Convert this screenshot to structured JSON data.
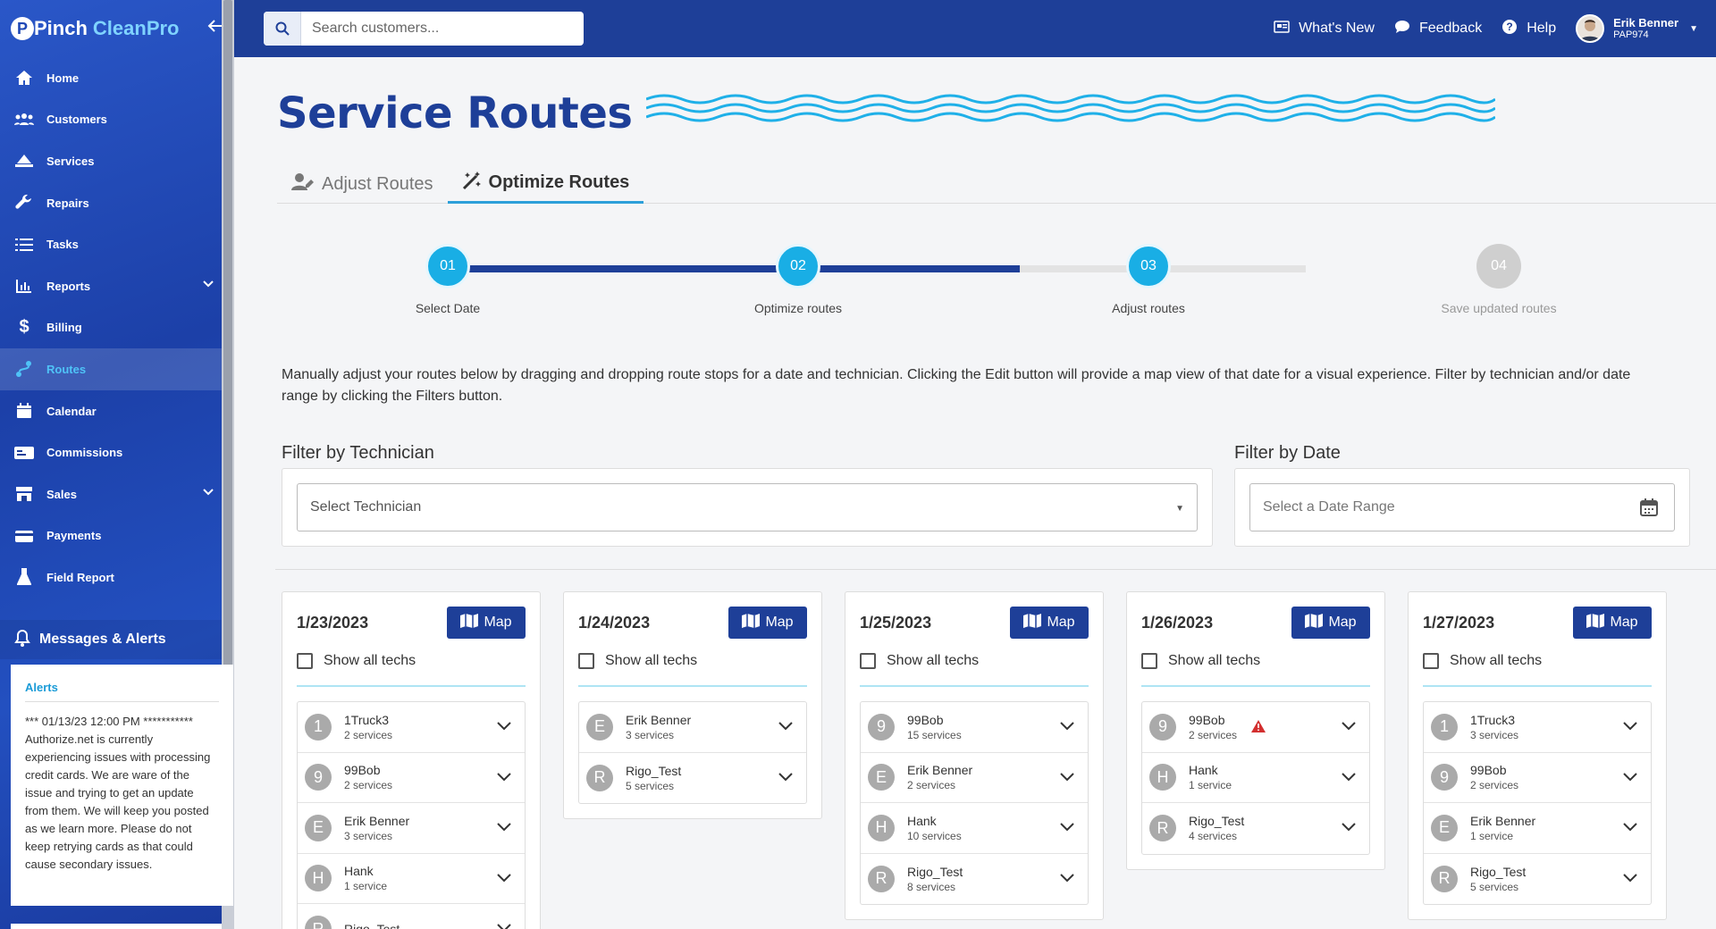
{
  "brand": {
    "name1": "Pinch",
    "name2": "CleanPro",
    "logo_letter": "P"
  },
  "sidebar": {
    "items": [
      {
        "label": "Home",
        "icon": "home-icon"
      },
      {
        "label": "Customers",
        "icon": "customers-icon"
      },
      {
        "label": "Services",
        "icon": "services-icon"
      },
      {
        "label": "Repairs",
        "icon": "wrench-icon"
      },
      {
        "label": "Tasks",
        "icon": "list-icon"
      },
      {
        "label": "Reports",
        "icon": "chart-icon"
      },
      {
        "label": "Billing",
        "icon": "dollar-icon"
      },
      {
        "label": "Routes",
        "icon": "route-icon"
      },
      {
        "label": "Calendar",
        "icon": "calendar-icon"
      },
      {
        "label": "Commissions",
        "icon": "commissions-icon"
      },
      {
        "label": "Sales",
        "icon": "store-icon"
      },
      {
        "label": "Payments",
        "icon": "payments-icon"
      },
      {
        "label": "Field Report",
        "icon": "flask-icon"
      }
    ],
    "messages_title": "Messages & Alerts",
    "alerts_title": "Alerts",
    "alert_text": "*** 01/13/23 12:00 PM *********** Authorize.net is currently experiencing issues with processing credit cards. We are ware of the issue and trying to get an update from them. We will keep you posted as we learn more. Please do not keep retrying cards as that could cause secondary issues."
  },
  "topbar": {
    "search_placeholder": "Search customers...",
    "whats_new": "What's New",
    "feedback": "Feedback",
    "help": "Help",
    "user_name": "Erik Benner",
    "user_code": "PAP974"
  },
  "page": {
    "title": "Service Routes",
    "tabs": [
      "Adjust Routes",
      "Optimize Routes"
    ],
    "steps": [
      {
        "num": "01",
        "label": "Select Date",
        "done": true
      },
      {
        "num": "02",
        "label": "Optimize routes",
        "done": true
      },
      {
        "num": "03",
        "label": "Adjust routes",
        "done": true
      },
      {
        "num": "04",
        "label": "Save updated routes",
        "done": false
      }
    ],
    "description": "Manually adjust your routes below by dragging and dropping route stops for a date and technician. Clicking the Edit button will provide a map view of that date for a visual experience. Filter by technician and/or date range by clicking the Filters button.",
    "filter_tech_label": "Filter by Technician",
    "filter_tech_placeholder": "Select Technician",
    "filter_date_label": "Filter by Date",
    "filter_date_placeholder": "Select a Date Range",
    "map_label": "Map",
    "show_all_label": "Show all techs"
  },
  "days": [
    {
      "date": "1/23/2023",
      "techs": [
        {
          "initial": "1",
          "name": "1Truck3",
          "count": "2 services"
        },
        {
          "initial": "9",
          "name": "99Bob",
          "count": "2 services"
        },
        {
          "initial": "E",
          "name": "Erik Benner",
          "count": "3 services"
        },
        {
          "initial": "H",
          "name": "Hank",
          "count": "1 service"
        },
        {
          "initial": "R",
          "name": "Rigo_Test",
          "count": ""
        }
      ]
    },
    {
      "date": "1/24/2023",
      "techs": [
        {
          "initial": "E",
          "name": "Erik Benner",
          "count": "3 services"
        },
        {
          "initial": "R",
          "name": "Rigo_Test",
          "count": "5 services"
        }
      ]
    },
    {
      "date": "1/25/2023",
      "techs": [
        {
          "initial": "9",
          "name": "99Bob",
          "count": "15 services"
        },
        {
          "initial": "E",
          "name": "Erik Benner",
          "count": "2 services"
        },
        {
          "initial": "H",
          "name": "Hank",
          "count": "10 services"
        },
        {
          "initial": "R",
          "name": "Rigo_Test",
          "count": "8 services"
        }
      ]
    },
    {
      "date": "1/26/2023",
      "techs": [
        {
          "initial": "9",
          "name": "99Bob",
          "count": "2 services",
          "warning": true
        },
        {
          "initial": "H",
          "name": "Hank",
          "count": "1 service"
        },
        {
          "initial": "R",
          "name": "Rigo_Test",
          "count": "4 services"
        }
      ]
    },
    {
      "date": "1/27/2023",
      "techs": [
        {
          "initial": "1",
          "name": "1Truck3",
          "count": "3 services"
        },
        {
          "initial": "9",
          "name": "99Bob",
          "count": "2 services"
        },
        {
          "initial": "E",
          "name": "Erik Benner",
          "count": "1 service"
        },
        {
          "initial": "R",
          "name": "Rigo_Test",
          "count": "5 services"
        }
      ]
    }
  ],
  "colors": {
    "primary": "#1e3f98",
    "accent": "#19aee5",
    "warning": "#d32f2f"
  }
}
